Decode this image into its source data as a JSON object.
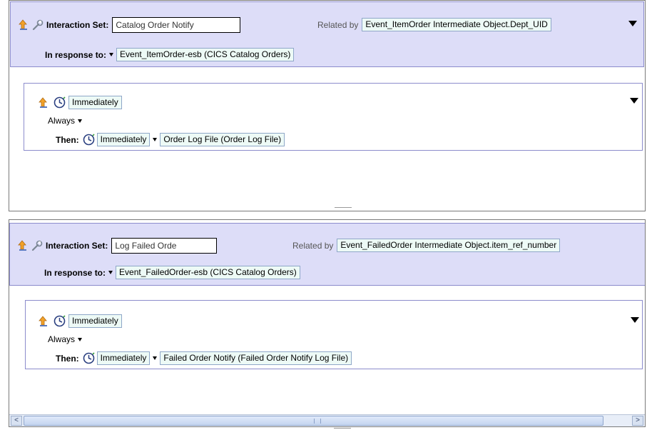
{
  "panels": [
    {
      "interaction_set_label": "Interaction Set:",
      "interaction_set_value": "Catalog Order Notify",
      "related_by_label": "Related by",
      "related_by_value": "Event_ItemOrder Intermediate Object.Dept_UID",
      "in_response_label": "In response to:",
      "in_response_value": "Event_ItemOrder-esb (CICS Catalog Orders)",
      "timing": "Immediately",
      "condition": "Always",
      "then_label": "Then:",
      "then_timing": "Immediately",
      "then_action": "Order Log File (Order Log File)"
    },
    {
      "interaction_set_label": "Interaction Set:",
      "interaction_set_value": "Log Failed Orde",
      "related_by_label": "Related by",
      "related_by_value": "Event_FailedOrder Intermediate Object.item_ref_number",
      "in_response_label": "In response to:",
      "in_response_value": "Event_FailedOrder-esb (CICS Catalog Orders)",
      "timing": "Immediately",
      "condition": "Always",
      "then_label": "Then:",
      "then_timing": "Immediately",
      "then_action": "Failed Order Notify (Failed Order Notify Log File)"
    }
  ],
  "scrollbar": {
    "left_arrow": "<",
    "right_arrow": ">"
  },
  "icons": {
    "move_up": "up-arrow-icon",
    "interaction_set": "wrench-icon",
    "timing": "clock-icon",
    "menu": "dropdown-triangle-icon"
  },
  "colors": {
    "header_bg": "#ddddf8",
    "field_bg": "#edfaf6",
    "border": "#8c8ccc"
  }
}
